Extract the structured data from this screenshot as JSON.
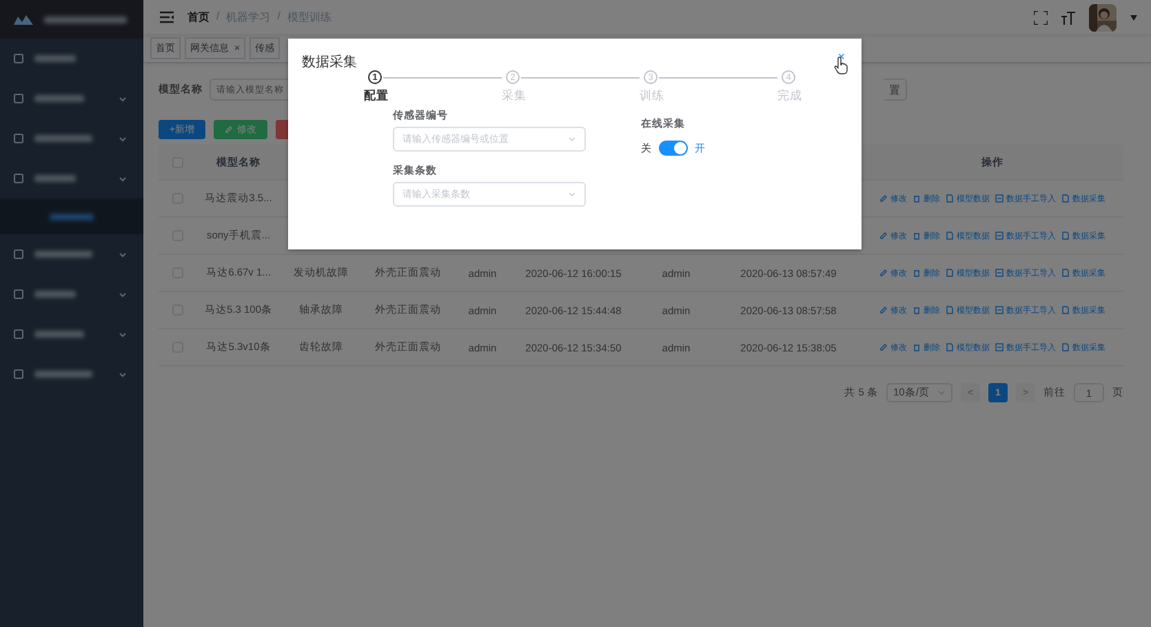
{
  "sidebar": {
    "items": [
      {
        "kind": "item",
        "expandable": false,
        "selected": false
      },
      {
        "kind": "item",
        "expandable": true,
        "selected": false
      },
      {
        "kind": "item",
        "expandable": true,
        "selected": false
      },
      {
        "kind": "item",
        "expandable": true,
        "selected": false
      },
      {
        "kind": "sub",
        "expandable": false,
        "selected": true
      },
      {
        "kind": "item",
        "expandable": true,
        "selected": false
      },
      {
        "kind": "item",
        "expandable": true,
        "selected": false
      },
      {
        "kind": "item",
        "expandable": true,
        "selected": false
      },
      {
        "kind": "item",
        "expandable": true,
        "selected": false
      }
    ]
  },
  "header": {
    "breadcrumb": [
      "首页",
      "机器学习",
      "模型训练"
    ],
    "separator": "/"
  },
  "tabs": [
    {
      "label": "首页"
    },
    {
      "label": "网关信息",
      "close_mark": "×"
    },
    {
      "label": "传感"
    }
  ],
  "search": {
    "label": "模型名称",
    "placeholder": "请输入模型名称",
    "button": "置"
  },
  "toolbar": [
    {
      "kind": "primary",
      "mark": "+",
      "label": "新增"
    },
    {
      "kind": "success",
      "label": "修改"
    },
    {
      "kind": "danger"
    }
  ],
  "table": {
    "header": {
      "checked": false,
      "name": "模型名称",
      "actions": "操作"
    },
    "rows": [
      {
        "checked": false,
        "cells": [
          "马达震动3.5..."
        ],
        "actions": [
          {
            "kind": "edit",
            "label": "修改"
          },
          {
            "kind": "delete",
            "label": "删除"
          },
          {
            "kind": "doc",
            "label": "模型数据"
          },
          {
            "kind": "import",
            "label": "数据手工导入"
          },
          {
            "kind": "doc",
            "label": "数据采集"
          }
        ]
      },
      {
        "checked": false,
        "cells": [
          "sony手机震..."
        ],
        "actions": [
          {
            "kind": "edit",
            "label": "修改"
          },
          {
            "kind": "delete",
            "label": "删除"
          },
          {
            "kind": "doc",
            "label": "模型数据"
          },
          {
            "kind": "import",
            "label": "数据手工导入"
          },
          {
            "kind": "doc",
            "label": "数据采集"
          }
        ]
      },
      {
        "checked": false,
        "cells": [
          "马达6.67v 1...",
          "发动机故障",
          "外壳正面震动",
          "admin",
          "2020-06-12 16:00:15",
          "admin",
          "2020-06-13 08:57:49"
        ],
        "actions": [
          {
            "kind": "edit",
            "label": "修改"
          },
          {
            "kind": "delete",
            "label": "删除"
          },
          {
            "kind": "doc",
            "label": "模型数据"
          },
          {
            "kind": "import",
            "label": "数据手工导入"
          },
          {
            "kind": "doc",
            "label": "数据采集"
          }
        ]
      },
      {
        "checked": false,
        "cells": [
          "马达5.3 100条",
          "轴承故障",
          "外壳正面震动",
          "admin",
          "2020-06-12 15:44:48",
          "admin",
          "2020-06-13 08:57:58"
        ],
        "actions": [
          {
            "kind": "edit",
            "label": "修改"
          },
          {
            "kind": "delete",
            "label": "删除"
          },
          {
            "kind": "doc",
            "label": "模型数据"
          },
          {
            "kind": "import",
            "label": "数据手工导入"
          },
          {
            "kind": "doc",
            "label": "数据采集"
          }
        ]
      },
      {
        "checked": false,
        "cells": [
          "马达5.3v10条",
          "齿轮故障",
          "外壳正面震动",
          "admin",
          "2020-06-12 15:34:50",
          "admin",
          "2020-06-12 15:38:05"
        ],
        "actions": [
          {
            "kind": "edit",
            "label": "修改"
          },
          {
            "kind": "delete",
            "label": "删除"
          },
          {
            "kind": "doc",
            "label": "模型数据"
          },
          {
            "kind": "import",
            "label": "数据手工导入"
          },
          {
            "kind": "doc",
            "label": "数据采集"
          }
        ]
      }
    ]
  },
  "pagination": {
    "total": "共 5 条",
    "page_size": "10条/页",
    "prev": "<",
    "next": ">",
    "pages": [
      {
        "label": "1",
        "selected": true
      }
    ],
    "goto_label": "前往",
    "goto_value": "1",
    "page_suffix": "页"
  },
  "dialog": {
    "title": "数据采集",
    "close": "×",
    "steps": [
      {
        "number": "1",
        "label": "配置",
        "active": true
      },
      {
        "number": "2",
        "label": "采集",
        "active": false
      },
      {
        "number": "3",
        "label": "训练",
        "active": false
      },
      {
        "number": "4",
        "label": "完成",
        "active": false
      }
    ],
    "fields": [
      {
        "label": "传感器编号",
        "placeholder": "请输入传感器编号或位置"
      },
      {
        "label": "采集条数",
        "placeholder": "请输入采集条数"
      }
    ],
    "switch": {
      "label": "在线采集",
      "off_text": "关",
      "on_text": "开",
      "on": true
    }
  }
}
